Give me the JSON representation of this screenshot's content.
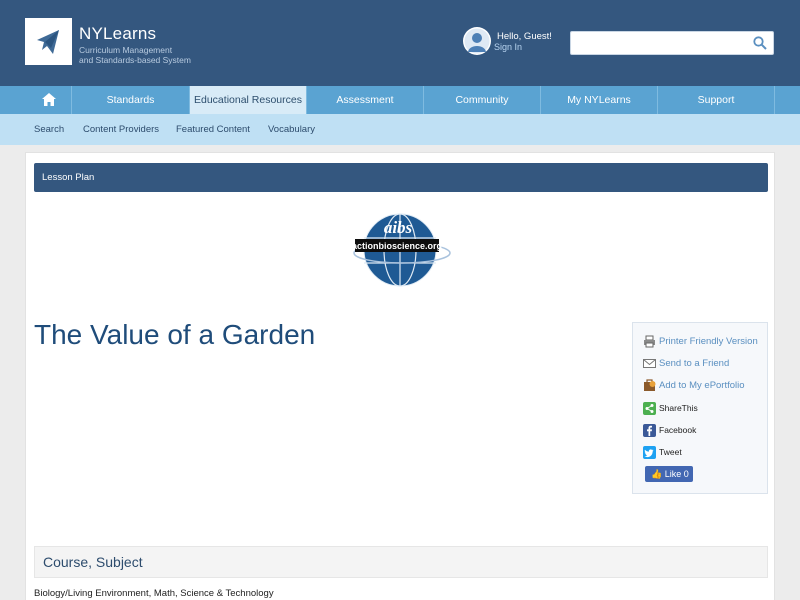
{
  "header": {
    "brand_name": "NYLearns",
    "brand_tagline_1": "Curriculum Management",
    "brand_tagline_2": "and Standards-based System",
    "greeting": "Hello,  Guest!",
    "signin_label": "Sign In",
    "search_placeholder": ""
  },
  "main_nav": {
    "items": [
      {
        "label": "Standards"
      },
      {
        "label": "Educational Resources"
      },
      {
        "label": "Assessment"
      },
      {
        "label": "Community"
      },
      {
        "label": "My NYLearns"
      },
      {
        "label": "Support"
      }
    ],
    "active_index": 1
  },
  "sub_nav": {
    "items": [
      {
        "label": "Search"
      },
      {
        "label": "Content Providers"
      },
      {
        "label": "Featured Content"
      },
      {
        "label": "Vocabulary"
      }
    ]
  },
  "content": {
    "section_label": "Lesson Plan",
    "provider_logo_top": "aibs",
    "provider_logo_bottom": "actionbioscience.org",
    "title": "The Value of a Garden",
    "share": {
      "printer": "Printer Friendly Version",
      "send": "Send to a Friend",
      "portfolio": "Add to My ePortfolio",
      "sharethis": "ShareThis",
      "facebook": "Facebook",
      "tweet": "Tweet",
      "like": "Like 0"
    },
    "course_heading": "Course, Subject",
    "course_value": "Biology/Living Environment, Math, Science & Technology"
  },
  "colors": {
    "header_bg": "#34577f",
    "nav_bg": "#5aa3d2",
    "subnav_bg": "#bfe0f4",
    "title_color": "#1f4c7a"
  }
}
